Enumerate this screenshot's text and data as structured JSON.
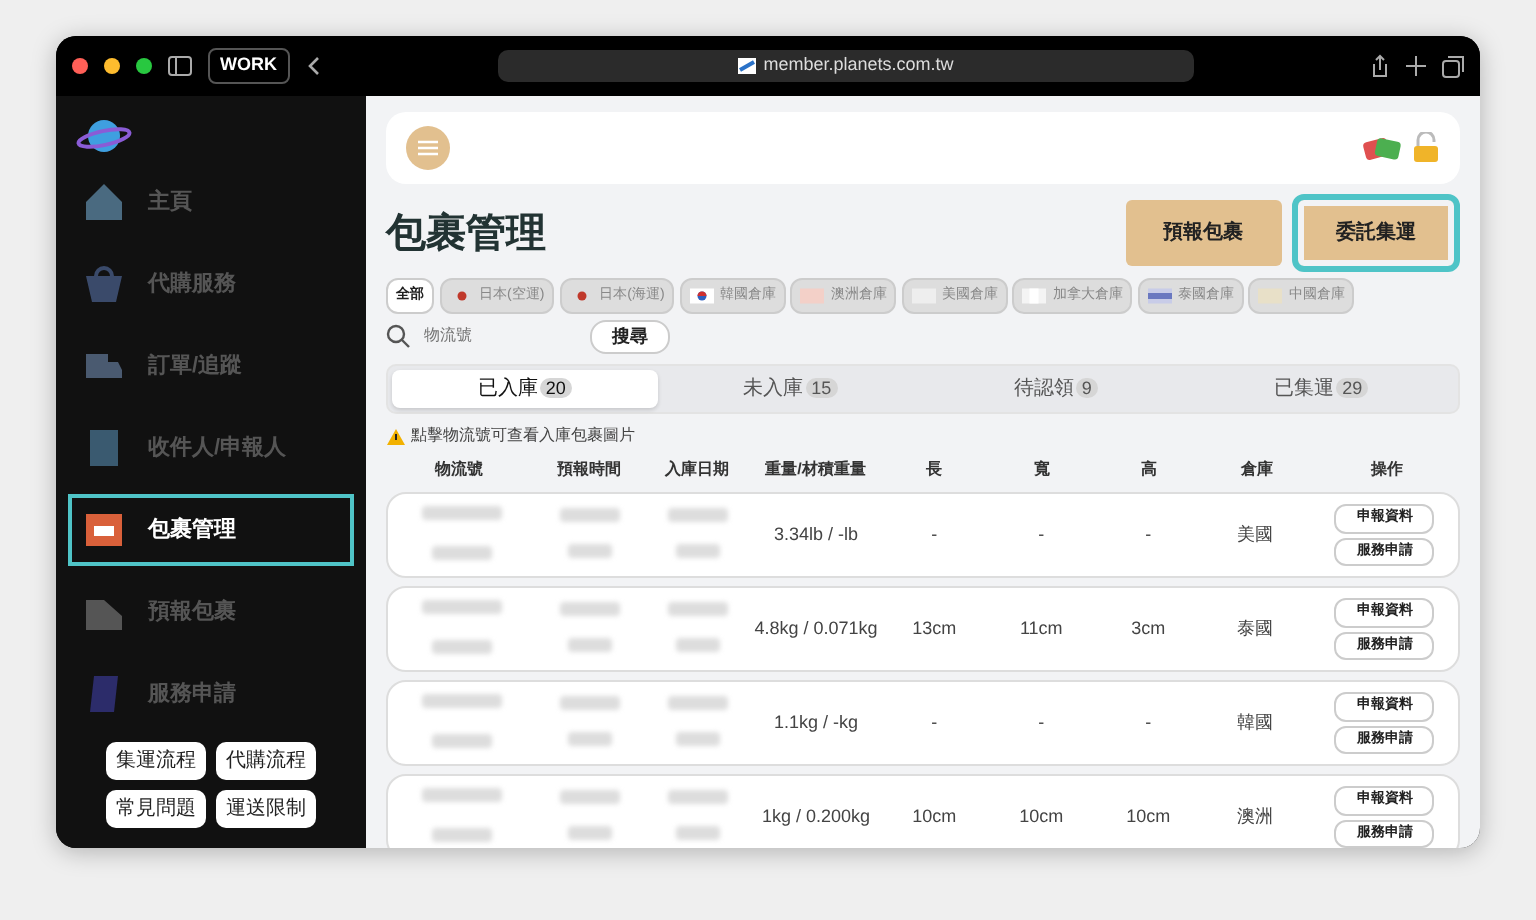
{
  "browser": {
    "profile": "WORK",
    "url": "member.planets.com.tw"
  },
  "sidebar": {
    "items": [
      {
        "label": "主頁",
        "selected": false,
        "highlighted": false
      },
      {
        "label": "代購服務",
        "selected": false,
        "highlighted": false
      },
      {
        "label": "訂單/追蹤",
        "selected": false,
        "highlighted": false
      },
      {
        "label": "收件人/申報人",
        "selected": false,
        "highlighted": false
      },
      {
        "label": "包裹管理",
        "selected": true,
        "highlighted": true
      },
      {
        "label": "預報包裹",
        "selected": false,
        "highlighted": false
      },
      {
        "label": "服務申請",
        "selected": false,
        "highlighted": false
      }
    ],
    "links": [
      "集運流程",
      "代購流程",
      "常見問題",
      "運送限制"
    ]
  },
  "page": {
    "title": "包裹管理",
    "actions": [
      {
        "label": "預報包裹",
        "highlighted": false
      },
      {
        "label": "委託集運",
        "highlighted": true
      }
    ]
  },
  "filters": [
    {
      "label": "全部",
      "selected": true
    },
    {
      "label": "日本(空運)",
      "selected": false
    },
    {
      "label": "日本(海運)",
      "selected": false
    },
    {
      "label": "韓國倉庫",
      "selected": false
    },
    {
      "label": "澳洲倉庫",
      "selected": false
    },
    {
      "label": "美國倉庫",
      "selected": false
    },
    {
      "label": "加拿大倉庫",
      "selected": false
    },
    {
      "label": "泰國倉庫",
      "selected": false
    },
    {
      "label": "中國倉庫",
      "selected": false
    }
  ],
  "search": {
    "placeholder": "物流號",
    "button": "搜尋"
  },
  "tabs": [
    {
      "label": "已入庫",
      "count": "20",
      "selected": true
    },
    {
      "label": "未入庫",
      "count": "15",
      "selected": false
    },
    {
      "label": "待認領",
      "count": "9",
      "selected": false
    },
    {
      "label": "已集運",
      "count": "29",
      "selected": false
    }
  ],
  "notice": "點擊物流號可查看入庫包裹圖片",
  "table": {
    "columns": [
      "物流號",
      "預報時間",
      "入庫日期",
      "重量/材積重量",
      "長",
      "寬",
      "高",
      "倉庫",
      "操作"
    ],
    "rows": [
      {
        "weight": "3.34lb / -lb",
        "length": "-",
        "width": "-",
        "height": "-",
        "warehouse": "美國",
        "actions": [
          "申報資料",
          "服務申請"
        ]
      },
      {
        "weight": "4.8kg / 0.071kg",
        "length": "13cm",
        "width": "11cm",
        "height": "3cm",
        "warehouse": "泰國",
        "actions": [
          "申報資料",
          "服務申請"
        ]
      },
      {
        "weight": "1.1kg / -kg",
        "length": "-",
        "width": "-",
        "height": "-",
        "warehouse": "韓國",
        "actions": [
          "申報資料",
          "服務申請"
        ]
      },
      {
        "weight": "1kg / 0.200kg",
        "length": "10cm",
        "width": "10cm",
        "height": "10cm",
        "warehouse": "澳洲",
        "actions": [
          "申報資料",
          "服務申請"
        ]
      }
    ]
  }
}
